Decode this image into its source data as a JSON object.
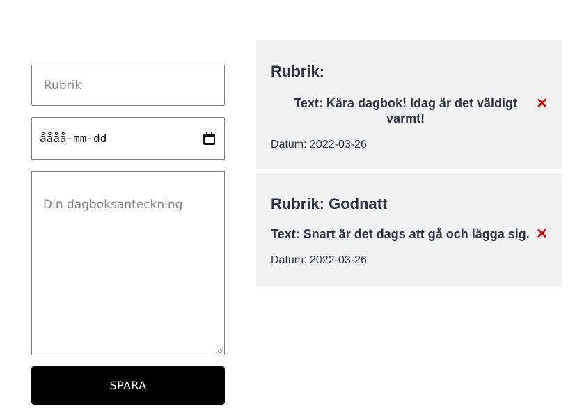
{
  "form": {
    "title_placeholder": "Rubrik",
    "date_placeholder": "åååå-mm-dd",
    "text_placeholder": "Din dagboksanteckning",
    "save_label": "SPARA"
  },
  "entries": [
    {
      "title": "Rubrik:",
      "text": "Text: Kära dagbok! Idag är det väldigt varmt!",
      "date": "Datum: 2022-03-26",
      "delete": "✕"
    },
    {
      "title": "Rubrik: Godnatt",
      "text": "Text: Snart är det dags att gå och lägga sig.",
      "date": "Datum: 2022-03-26",
      "delete": "✕"
    }
  ],
  "colors": {
    "accent_delete": "#e60000",
    "button_bg": "#000000",
    "card_bg": "#f2f2f2"
  }
}
